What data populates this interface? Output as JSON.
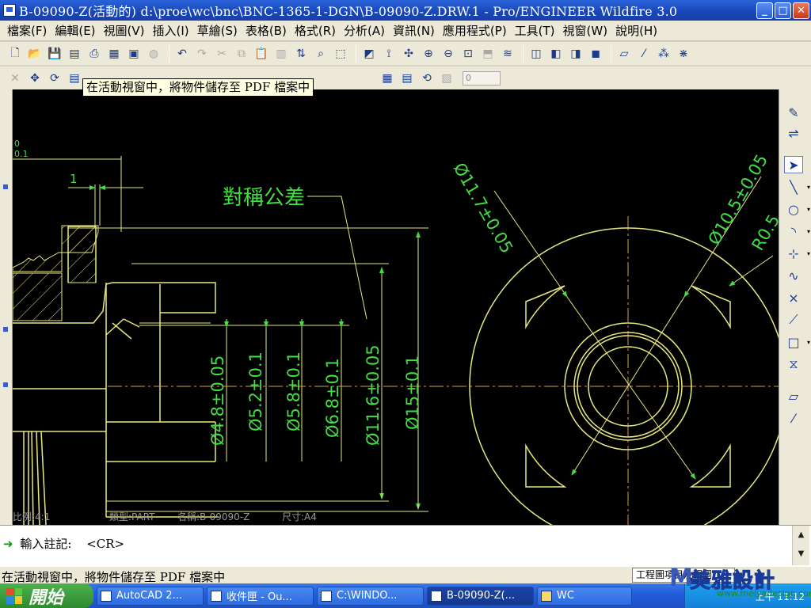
{
  "window": {
    "title": "B-09090-Z(活動的) d:\\proe\\wc\\bnc\\BNC-1365-1-DGN\\B-09090-Z.DRW.1 - Pro/ENGINEER Wildfire 3.0",
    "min": "_",
    "max": "□",
    "close": "✕"
  },
  "menubar": {
    "items": [
      "檔案(F)",
      "編輯(E)",
      "視圖(V)",
      "插入(I)",
      "草繪(S)",
      "表格(B)",
      "格式(R)",
      "分析(A)",
      "資訊(N)",
      "應用程式(P)",
      "工具(T)",
      "視窗(W)",
      "說明(H)"
    ]
  },
  "toolbar2": {
    "spin_value": "0"
  },
  "tooltip": "在活動視窗中，將物件儲存至 PDF 檔案中",
  "drawing": {
    "line_color": "#e8e880",
    "dim_color": "#44dd44",
    "center_color": "#d8a040",
    "dim_top": "0",
    "dim_sub": "0.1",
    "dim_one": "1",
    "note_label": "對稱公差",
    "dims_vertical": [
      "Ø4.8±0.05",
      "Ø5.2±0.1",
      "Ø5.8±0.1",
      "Ø6.8±0.1",
      "Ø11.6±0.05",
      "Ø15±0.1"
    ],
    "dim_diag_left": "Ø11.7±0.05",
    "dim_diag_right": "Ø10.5±0.05",
    "dim_radius": "R0.5",
    "tb_scale": "比例:4:1",
    "tb_type": "類型:PART",
    "tb_name": "名稱:B-09090-Z",
    "tb_size": "尺寸:A4"
  },
  "message": {
    "prompt": "輸入註記:",
    "cr": "<CR>"
  },
  "status": {
    "text": "在活動視窗中，將物件儲存至 PDF 檔案中",
    "filter": "工程圖項目及視圖"
  },
  "taskbar": {
    "start": "開始",
    "tasks": [
      "AutoCAD 2...",
      "收件匣 - Ou...",
      "C:\\WINDO...",
      "B-09090-Z(...",
      "WC"
    ],
    "clock": "上午 11:12"
  },
  "watermark": {
    "text": "美雅設計",
    "url": "www.meiyadesign.com"
  }
}
